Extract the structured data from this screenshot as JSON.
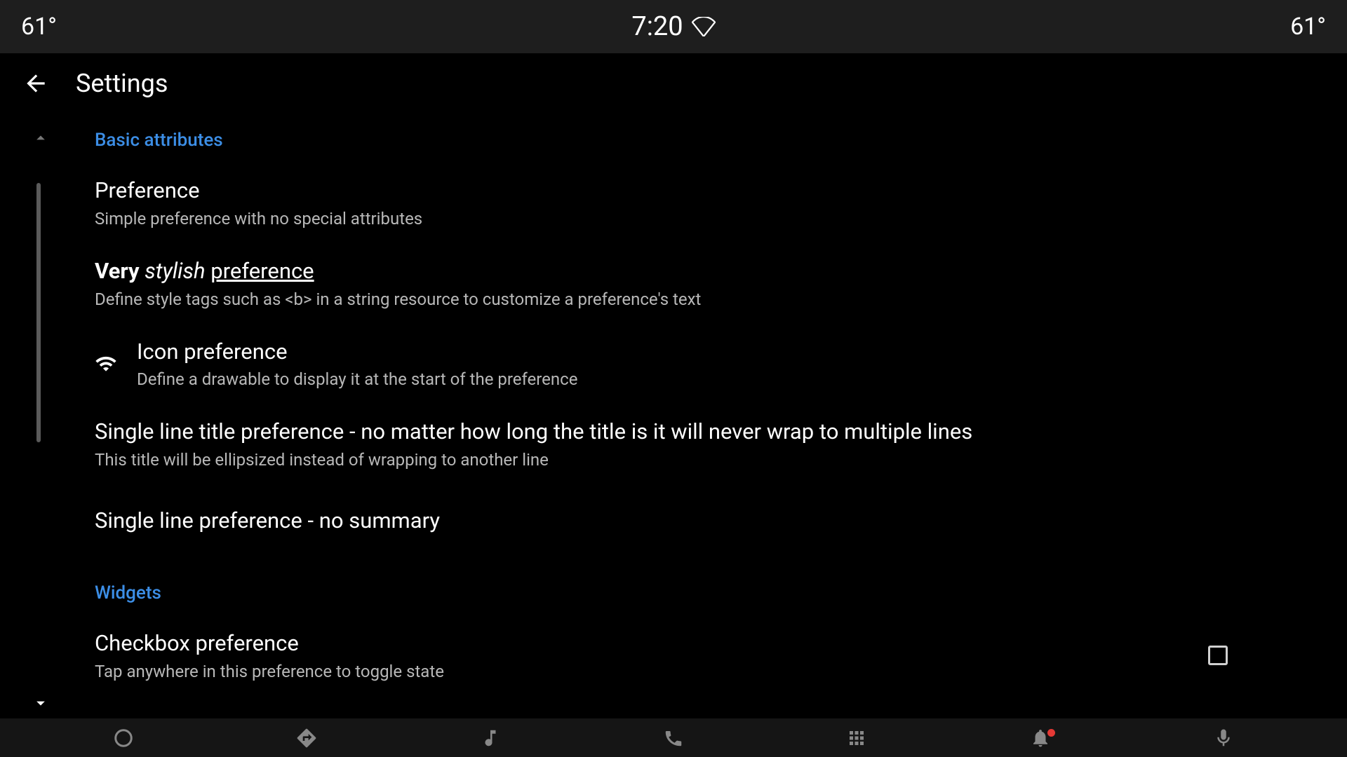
{
  "status": {
    "temp_left": "61°",
    "time": "7:20",
    "temp_right": "61°"
  },
  "appbar": {
    "title": "Settings"
  },
  "categories": {
    "basic": "Basic attributes",
    "widgets": "Widgets"
  },
  "prefs": {
    "simple": {
      "title": "Preference",
      "summary": "Simple preference with no special attributes"
    },
    "stylish": {
      "title_bold": "Very",
      "title_italic": "stylish",
      "title_underline": "preference",
      "summary": "Define style tags such as <b> in a string resource to customize a preference's text"
    },
    "icon": {
      "title": "Icon preference",
      "summary": "Define a drawable to display it at the start of the preference"
    },
    "singleline": {
      "title": "Single line title preference - no matter how long the title is it will never wrap to multiple lines",
      "summary": "This title will be ellipsized instead of wrapping to another line"
    },
    "nosummary": {
      "title": "Single line preference - no summary"
    },
    "checkbox": {
      "title": "Checkbox preference",
      "summary": "Tap anywhere in this preference to toggle state",
      "checked": false
    }
  }
}
